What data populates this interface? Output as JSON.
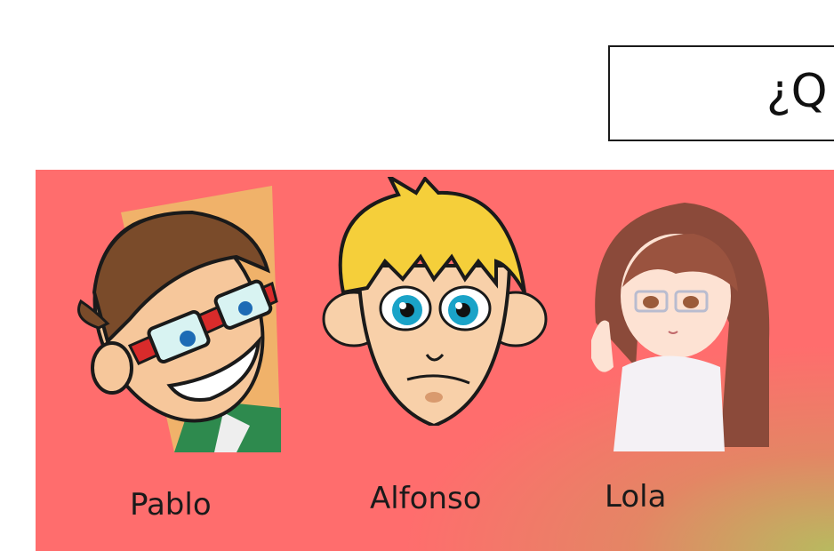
{
  "slide": {
    "question": "¿Q",
    "characters": [
      {
        "name": "Pablo"
      },
      {
        "name": "Alfonso"
      },
      {
        "name": "Lola"
      }
    ]
  }
}
